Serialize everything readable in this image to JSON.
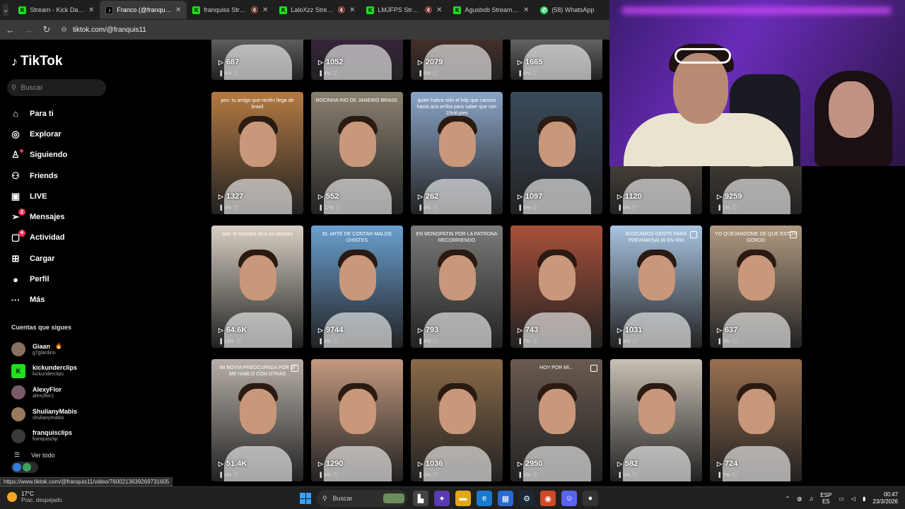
{
  "browser": {
    "tabs": [
      {
        "title": "Stream - Kick Dashbo",
        "icon": "kick",
        "active": false,
        "muted": false
      },
      {
        "title": "Franco (@franquis11)",
        "icon": "tiktok",
        "active": true,
        "muted": false
      },
      {
        "title": "franquiss Stream",
        "icon": "kick",
        "active": false,
        "muted": true
      },
      {
        "title": "LaloXzz Stream",
        "icon": "kick",
        "active": false,
        "muted": true
      },
      {
        "title": "LMJFPS Stream -",
        "icon": "kick",
        "active": false,
        "muted": true
      },
      {
        "title": "Agusbob Stream - W",
        "icon": "kick",
        "active": false,
        "muted": false
      },
      {
        "title": "(58) WhatsApp",
        "icon": "whatsapp",
        "active": false,
        "muted": false
      }
    ],
    "url": "tiktok.com/@franquis11",
    "status_url": "https://www.tiktok.com/@franquis11/video/7600213639269731605"
  },
  "sidebar": {
    "logo": "TikTok",
    "search_placeholder": "Buscar",
    "nav": [
      {
        "label": "Para ti",
        "icon": "home-icon",
        "glyph": "⌂"
      },
      {
        "label": "Explorar",
        "icon": "compass-icon",
        "glyph": "◎"
      },
      {
        "label": "Siguiendo",
        "icon": "following-icon",
        "glyph": "♙",
        "dot": true
      },
      {
        "label": "Friends",
        "icon": "friends-icon",
        "glyph": "⚇"
      },
      {
        "label": "LIVE",
        "icon": "live-icon",
        "glyph": "▣"
      },
      {
        "label": "Mensajes",
        "icon": "messages-icon",
        "glyph": "➢",
        "badge": "2"
      },
      {
        "label": "Actividad",
        "icon": "activity-icon",
        "glyph": "▢",
        "badge": "4"
      },
      {
        "label": "Cargar",
        "icon": "upload-icon",
        "glyph": "⊞"
      },
      {
        "label": "Perfil",
        "icon": "profile-avatar",
        "glyph": "●"
      },
      {
        "label": "Más",
        "icon": "more-icon",
        "glyph": "···"
      }
    ],
    "following_title": "Cuentas que sigues",
    "following": [
      {
        "name": "Giaan",
        "user": "g7glardino",
        "color": "#8a7060",
        "flame": true
      },
      {
        "name": "kickunderclips",
        "user": "kickunderclips",
        "color": "#1fe01f"
      },
      {
        "name": "AlexyFlor",
        "user": "alexyflor1",
        "color": "#7a5a6a"
      },
      {
        "name": "ShulianyMabis",
        "user": "shulianymabis",
        "color": "#9a7a5a"
      },
      {
        "name": "franquisclips",
        "user": "franquisclip",
        "color": "#3a3a3a"
      }
    ],
    "see_all": "Ver todo"
  },
  "videos": [
    {
      "views": "687",
      "pct": "4%",
      "bg": "#d9d6d0",
      "cap": ""
    },
    {
      "views": "1052",
      "pct": "4%",
      "bg": "#5a2a6a",
      "cap": ""
    },
    {
      "views": "2079",
      "pct": "6%",
      "bg": "#8a4a3a",
      "cap": ""
    },
    {
      "views": "1665",
      "pct": "4%",
      "bg": "#e8e8e8",
      "cap": ""
    },
    {
      "views": "1327",
      "pct": "4%",
      "bg": "#b57a42",
      "cap": "pov: tu amigo que recién llega de brasil"
    },
    {
      "views": "552",
      "pct": "17%",
      "bg": "#8a8070",
      "cap": "ROCINHA RIO DE JANEIRO BRASIL"
    },
    {
      "views": "262",
      "pct": "6%",
      "bg": "#8aa5c8",
      "cap": "quien habra sido el hdp que camino hasta aca arriba para saber que son 10mil pies"
    },
    {
      "views": "1097",
      "pct": "5%",
      "bg": "#3a4a5a",
      "cap": ""
    },
    {
      "views": "1120",
      "pct": "6%",
      "bg": "#7a6a55",
      "cap": ""
    },
    {
      "views": "9259",
      "pct": "1%",
      "bg": "#6a5a48",
      "cap": ""
    },
    {
      "views": "64.6K",
      "pct": "19%",
      "bg": "#d8d0c4",
      "cap": "pov: te muestra rio a su cerveza"
    },
    {
      "views": "9744",
      "pct": "4%",
      "bg": "#6aa0d0",
      "cap": "EL ARTE DE CONTAR MALOS CHISTES"
    },
    {
      "views": "793",
      "pct": "4%",
      "bg": "#7a7a78",
      "cap": "EN MONOPATIN POR LA PATRONA RECORRIENDO"
    },
    {
      "views": "743",
      "pct": "7%",
      "bg": "#a8503a",
      "cap": ""
    },
    {
      "views": "1031",
      "pct": "4%",
      "bg": "#a8c4e0",
      "cap": "BUSCAMOS GENTE PARA PREVIAR/SALIR EN RIO",
      "multi": true
    },
    {
      "views": "637",
      "pct": "5%",
      "bg": "#b09a80",
      "cap": "YO QUEJANDOME DE QUE ESTOY GORDO",
      "multi": true
    },
    {
      "views": "51.4K",
      "pct": "4%",
      "bg": "#b8b0a8",
      "cap": "MI NOVIA PREOCUPADA POR SI ME HABLO CON OTRAS",
      "multi": true
    },
    {
      "views": "1290",
      "pct": "6%",
      "bg": "#c49a80",
      "cap": ""
    },
    {
      "views": "1036",
      "pct": "5%",
      "bg": "#8a6a48",
      "cap": ""
    },
    {
      "views": "2950",
      "pct": "3%",
      "bg": "#6a5a50",
      "cap": "HOY POR MI...",
      "multi": true
    },
    {
      "views": "582",
      "pct": "5%",
      "bg": "#c8c0b4",
      "cap": ""
    },
    {
      "views": "724",
      "pct": "7%",
      "bg": "#9a7050",
      "cap": ""
    }
  ],
  "taskbar": {
    "weather_temp": "17°C",
    "weather_desc": "Prac. despejado",
    "search_label": "Buscar",
    "lang1": "ESP",
    "lang2": "ES",
    "time": "00:47",
    "date": "23/3/2026"
  }
}
